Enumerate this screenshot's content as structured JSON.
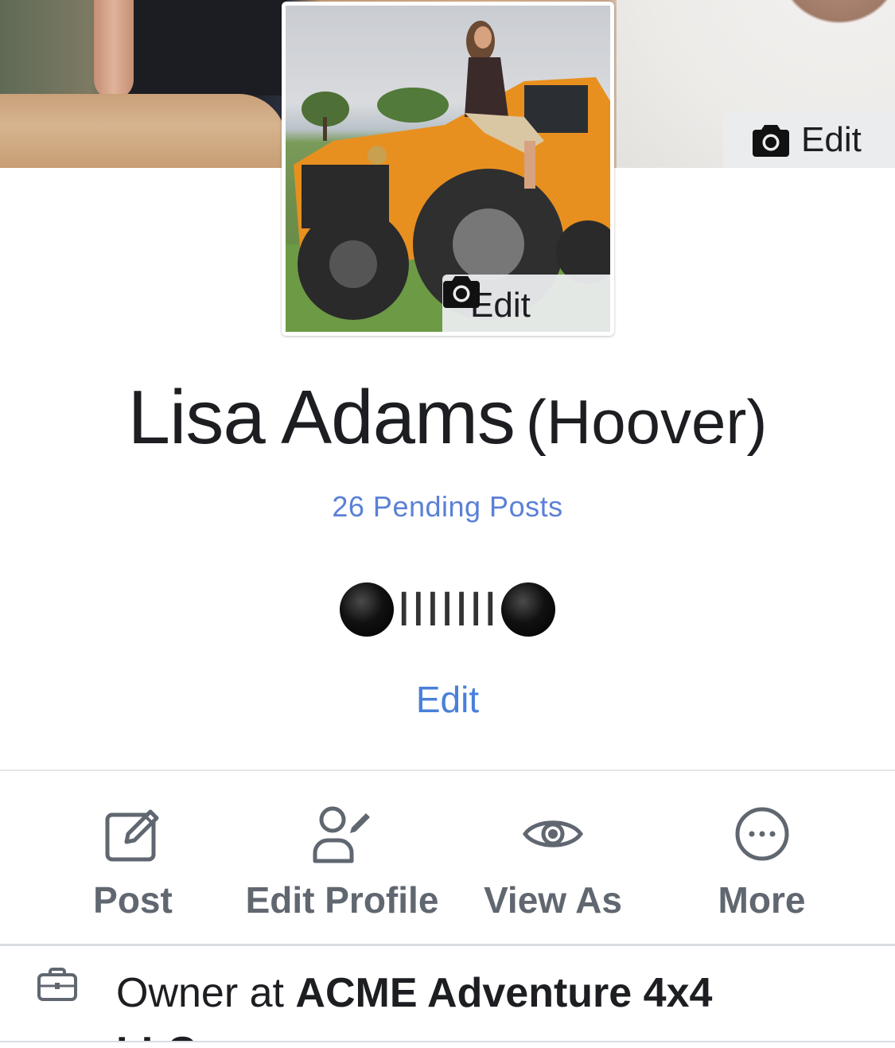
{
  "profile": {
    "name": "Lisa Adams",
    "alternate_name": "(Hoover)",
    "pending_posts": "26 Pending Posts",
    "bio": {
      "grill": "IIIIIII",
      "edit_label": "Edit"
    },
    "cover_edit_label": "Edit",
    "picture_edit_label": "Edit"
  },
  "actions": [
    {
      "label": "Post",
      "icon": "compose-icon"
    },
    {
      "label": "Edit Profile",
      "icon": "edit-profile-icon"
    },
    {
      "label": "View As",
      "icon": "eye-icon"
    },
    {
      "label": "More",
      "icon": "more-icon"
    }
  ],
  "work": {
    "prefix": "Owner at ",
    "company": "ACME Adventure 4x4",
    "company_cont": "LLC",
    "icon": "briefcase-icon"
  },
  "colors": {
    "link_blue": "#5b80d6",
    "edit_blue": "#4a7fdb",
    "action_gray": "#606770",
    "jeep_orange": "#e8901f"
  }
}
